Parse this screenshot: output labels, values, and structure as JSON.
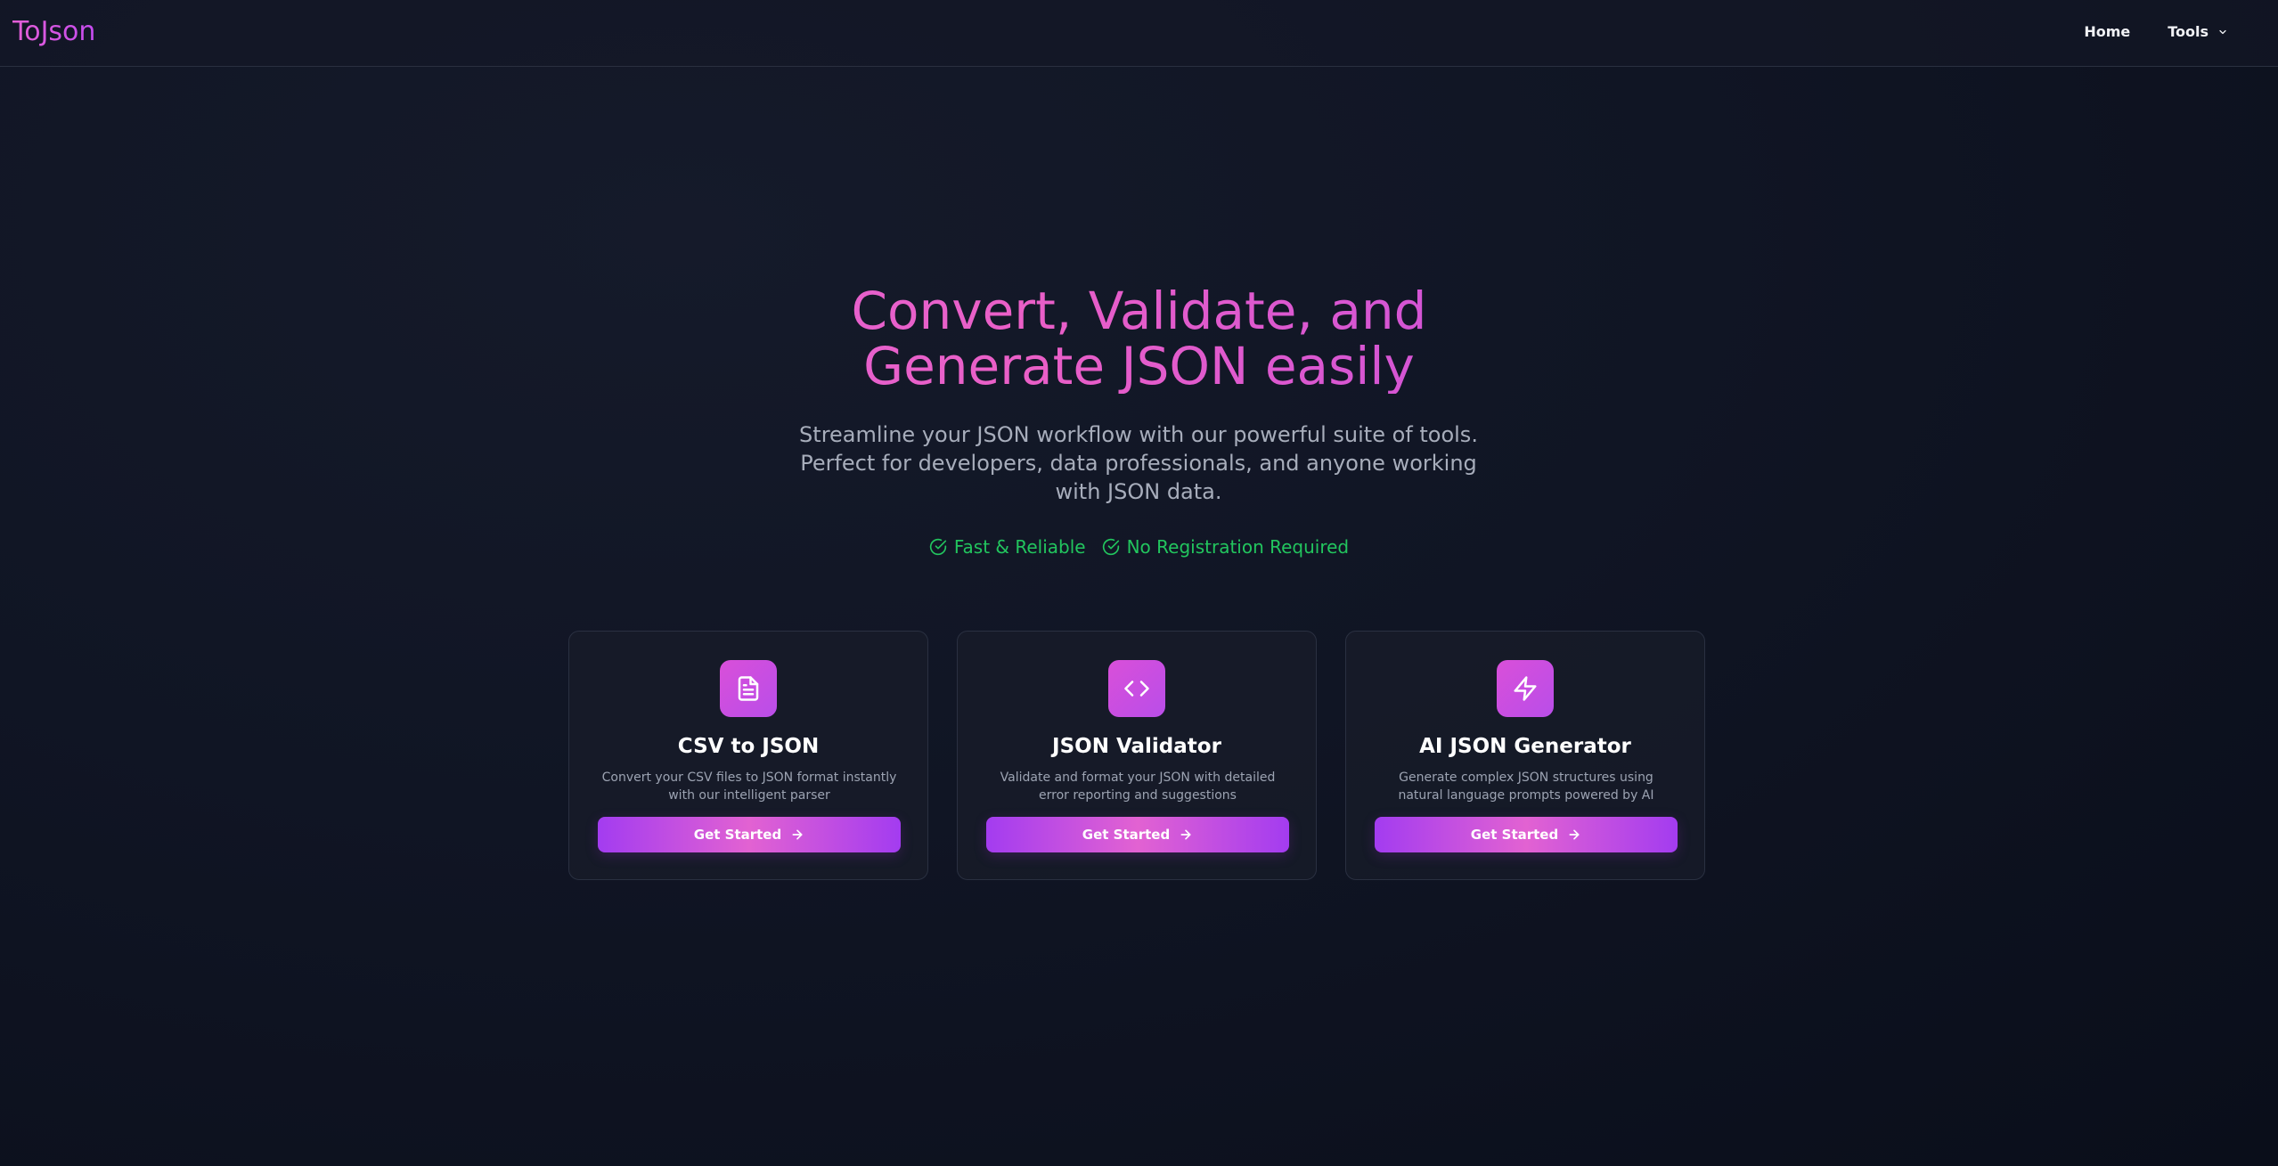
{
  "brand": {
    "name": "ToJson"
  },
  "nav": {
    "home": "Home",
    "tools": "Tools"
  },
  "hero": {
    "title_line1": "Convert, Validate, and",
    "title_line2": "Generate JSON easily",
    "subtitle": "Streamline your JSON workflow with our powerful suite of tools. Perfect for developers, data professionals, and anyone working with JSON data."
  },
  "features": [
    {
      "label": "Fast & Reliable",
      "icon": "check-circle-icon"
    },
    {
      "label": "No Registration Required",
      "icon": "check-circle-icon"
    }
  ],
  "cards": [
    {
      "title": "CSV to JSON",
      "description": "Convert your CSV files to JSON format instantly with our intelligent parser",
      "button": "Get Started",
      "icon": "file-text-icon"
    },
    {
      "title": "JSON Validator",
      "description": "Validate and format your JSON with detailed error reporting and suggestions",
      "button": "Get Started",
      "icon": "code-icon"
    },
    {
      "title": "AI JSON Generator",
      "description": "Generate complex JSON structures using natural language prompts powered by AI",
      "button": "Get Started",
      "icon": "zap-icon"
    }
  ],
  "colors": {
    "accent_pink": "#e45fd6",
    "accent_purple": "#a33cf0",
    "success_green": "#22c55e",
    "background": "#0f1320"
  }
}
